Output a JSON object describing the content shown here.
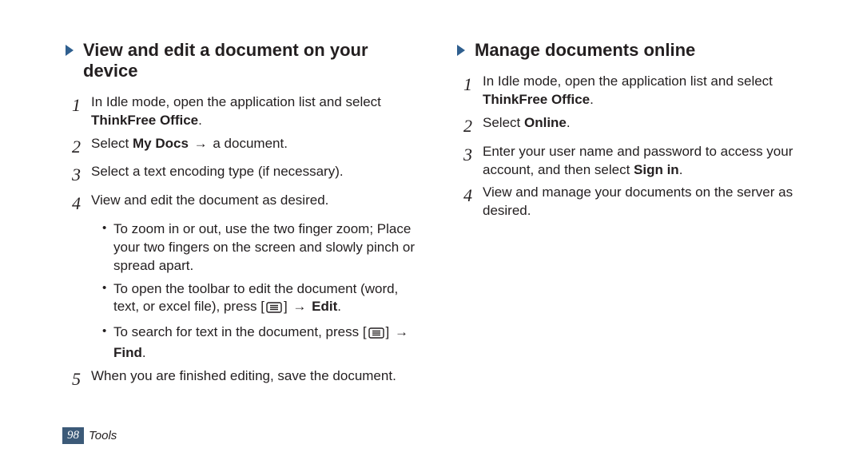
{
  "left": {
    "heading": "View and edit a document on your device",
    "steps": [
      {
        "prefix": "In Idle mode, open the application list and select ",
        "bold": "ThinkFree Office",
        "suffix": "."
      },
      {
        "prefix": "Select ",
        "bold": "My Docs",
        "suffix_before_arrow": " ",
        "arrow": "→",
        "suffix": " a document."
      },
      {
        "text": "Select a text encoding type (if necessary)."
      },
      {
        "text": "View and edit the document as desired."
      },
      {
        "text": "When you are finished editing, save the document."
      }
    ],
    "bullets": [
      {
        "text": "To zoom in or out, use the two finger zoom; Place your two fingers on the screen and slowly pinch or spread apart."
      },
      {
        "prefix": "To open the toolbar to edit the document (word, text, or excel file), press [",
        "icon": true,
        "mid": "] ",
        "arrow": "→",
        "bold": " Edit",
        "suffix": "."
      },
      {
        "prefix": "To search for text in the document, press [",
        "icon": true,
        "mid": "] ",
        "arrow": "→",
        "bold": " Find",
        "suffix": "."
      }
    ]
  },
  "right": {
    "heading": "Manage documents online",
    "steps": [
      {
        "prefix": "In Idle mode, open the application list and select ",
        "bold": "ThinkFree Office",
        "suffix": "."
      },
      {
        "prefix": "Select ",
        "bold": "Online",
        "suffix": "."
      },
      {
        "prefix": "Enter your user name and password to access your account, and then select ",
        "bold": "Sign in",
        "suffix": "."
      },
      {
        "text": "View and manage your documents on the server as desired."
      }
    ]
  },
  "footer": {
    "page": "98",
    "section": "Tools"
  }
}
